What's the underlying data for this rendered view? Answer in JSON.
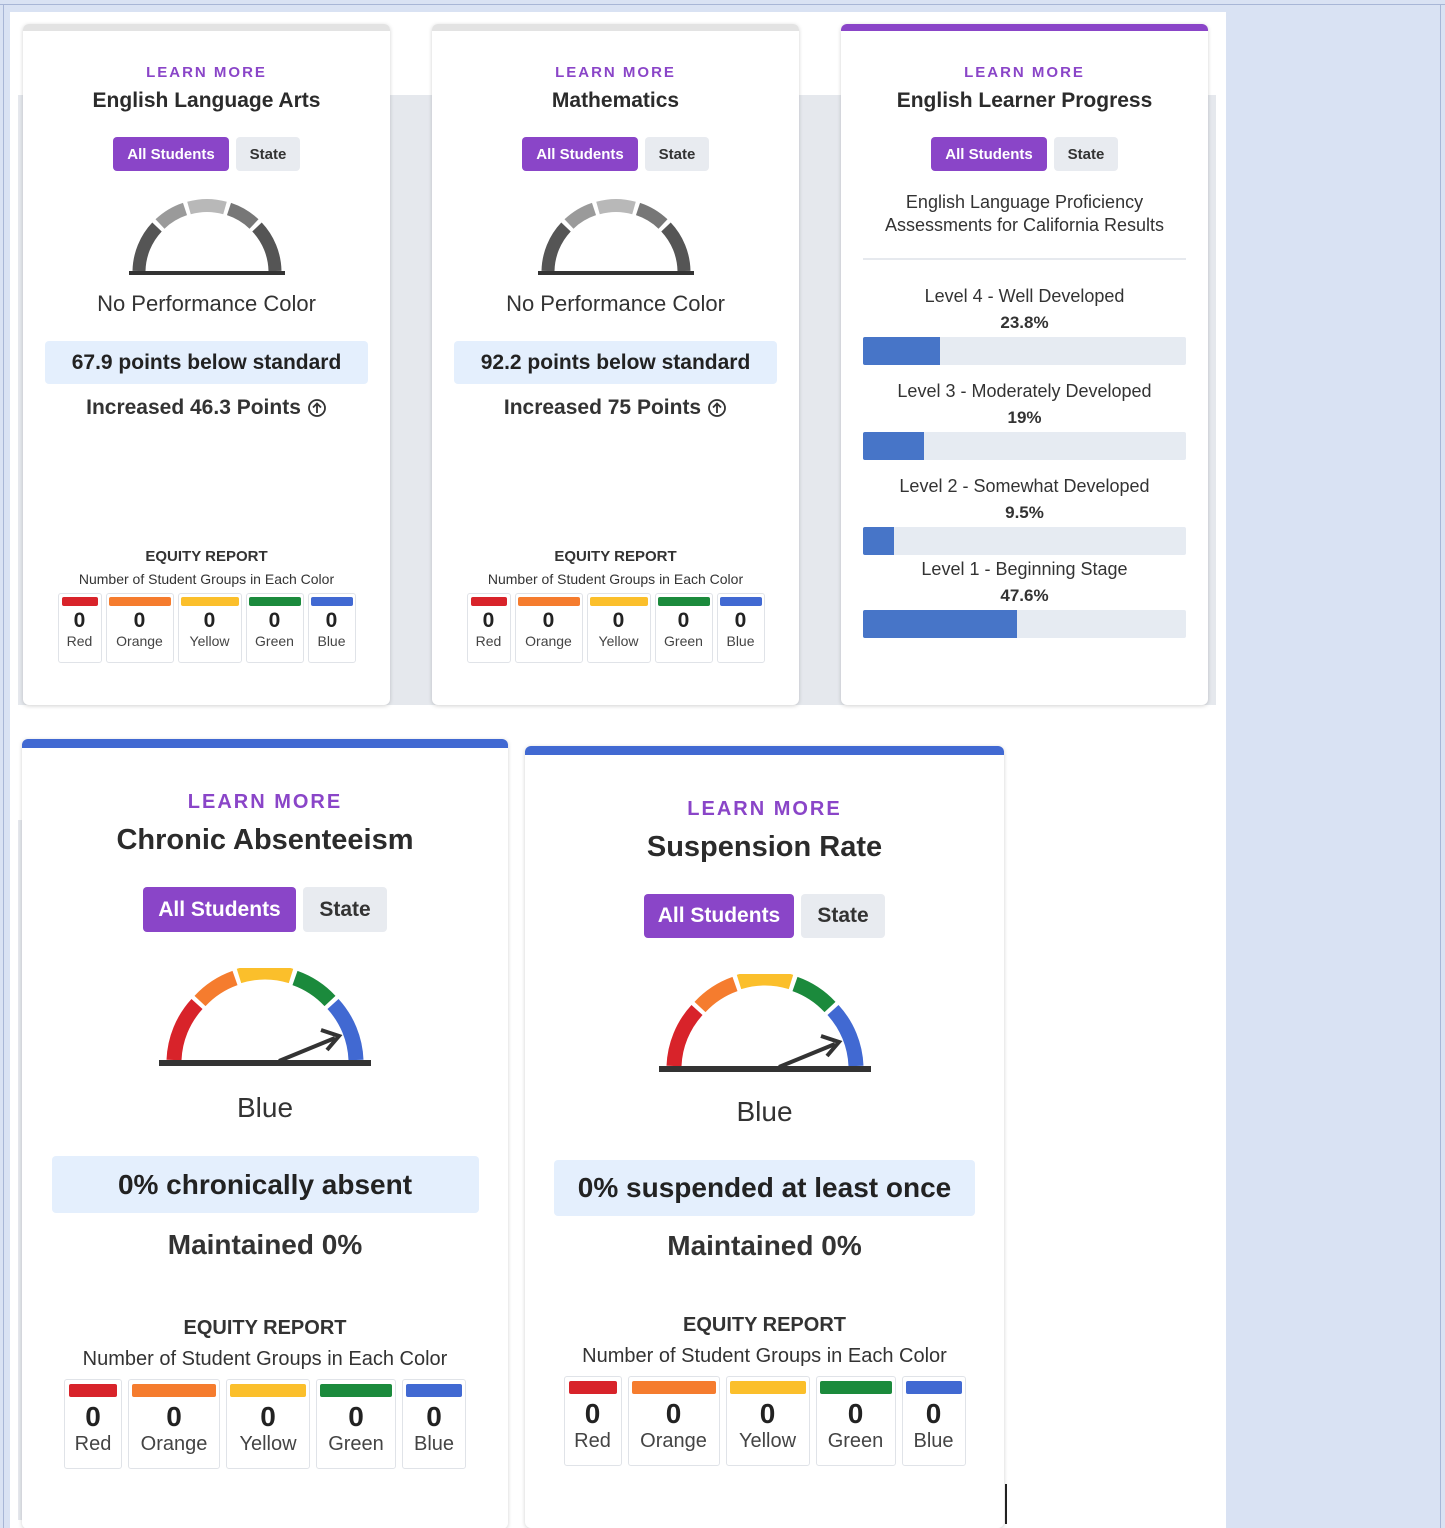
{
  "colors": {
    "purple": "#8a45c8",
    "blue": "#4775c8",
    "red": "#d8232a",
    "orange": "#f57c2e",
    "yellow": "#fbbf2b",
    "green": "#1b8a3c",
    "eq_blue": "#4169d2"
  },
  "equity": {
    "title": "EQUITY REPORT",
    "subtitle": "Number of Student Groups in Each Color",
    "labels": [
      "Red",
      "Orange",
      "Yellow",
      "Green",
      "Blue"
    ]
  },
  "cards": {
    "ela": {
      "learn_more": "LEARN MORE",
      "title": "English Language Arts",
      "toggle": [
        "All Students",
        "State"
      ],
      "performance_color": "No Performance Color",
      "status": "67.9 points below standard",
      "change": "Increased 46.3 Points",
      "equity_counts": [
        "0",
        "0",
        "0",
        "0",
        "0"
      ]
    },
    "math": {
      "learn_more": "LEARN MORE",
      "title": "Mathematics",
      "toggle": [
        "All Students",
        "State"
      ],
      "performance_color": "No Performance Color",
      "status": "92.2 points below standard",
      "change": "Increased 75 Points",
      "equity_counts": [
        "0",
        "0",
        "0",
        "0",
        "0"
      ]
    },
    "elp": {
      "learn_more": "LEARN MORE",
      "title": "English Learner Progress",
      "toggle": [
        "All Students",
        "State"
      ],
      "subtitle": "English Language Proficiency Assessments for California Results",
      "levels": [
        {
          "label": "Level 4 - Well Developed",
          "pct": "23.8%",
          "value": 23.8
        },
        {
          "label": "Level 3 - Moderately Developed",
          "pct": "19%",
          "value": 19
        },
        {
          "label": "Level 2 - Somewhat Developed",
          "pct": "9.5%",
          "value": 9.5
        },
        {
          "label": "Level 1 - Beginning Stage",
          "pct": "47.6%",
          "value": 47.6
        }
      ]
    },
    "absent": {
      "learn_more": "LEARN MORE",
      "title": "Chronic Absenteeism",
      "toggle": [
        "All Students",
        "State"
      ],
      "performance_color": "Blue",
      "status": "0% chronically absent",
      "change": "Maintained 0%",
      "equity_counts": [
        "0",
        "0",
        "0",
        "0",
        "0"
      ]
    },
    "suspend": {
      "learn_more": "LEARN MORE",
      "title": "Suspension Rate",
      "toggle": [
        "All Students",
        "State"
      ],
      "performance_color": "Blue",
      "status": "0% suspended at least once",
      "change": "Maintained 0%",
      "equity_counts": [
        "0",
        "0",
        "0",
        "0",
        "0"
      ]
    }
  }
}
